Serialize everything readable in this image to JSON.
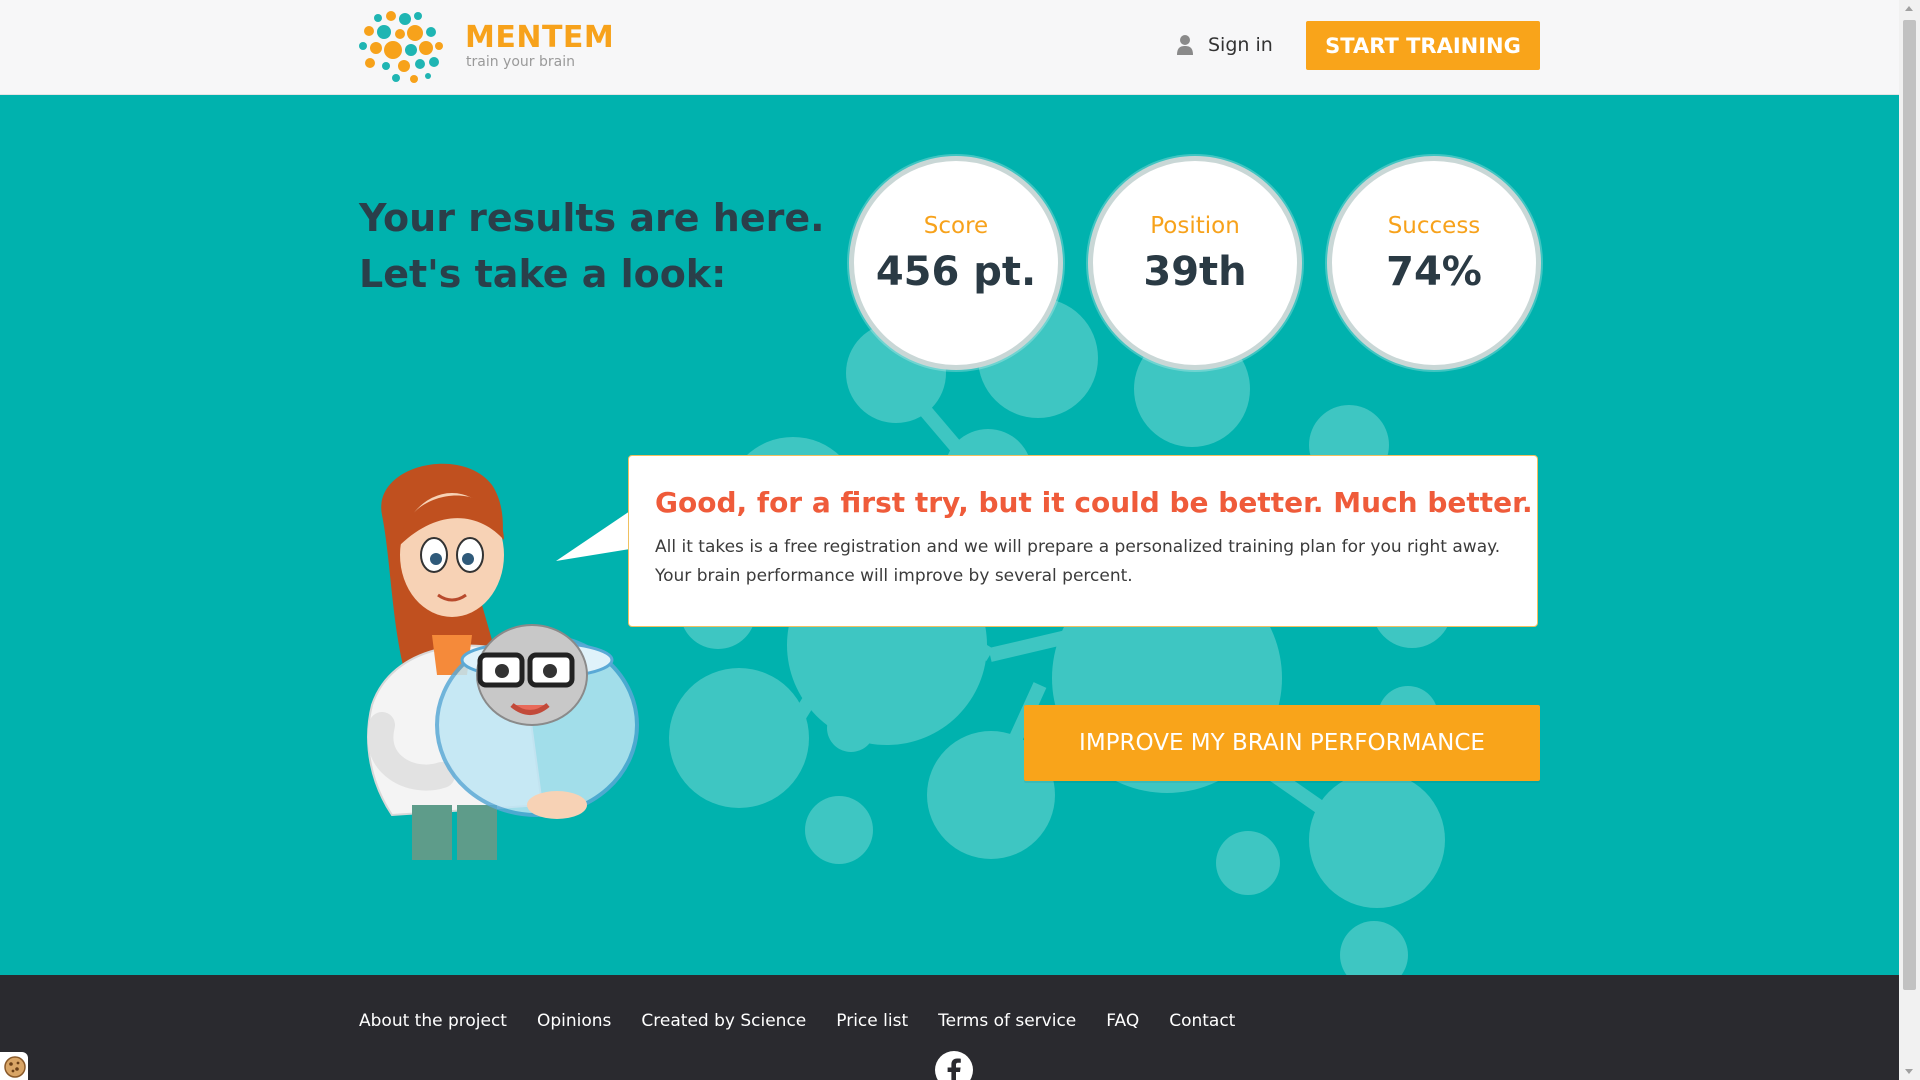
{
  "header": {
    "brand_name": "MENTEM",
    "brand_tagline": "train your brain",
    "signin_label": "Sign in",
    "start_button_label": "START TRAINING",
    "icons": {
      "logo": "molecule-logo-icon",
      "signin": "person-icon"
    }
  },
  "hero": {
    "headline_line1": "Your results are here.",
    "headline_line2": "Let's take a look:",
    "stats": [
      {
        "label": "Score",
        "value": "456 pt."
      },
      {
        "label": "Position",
        "value": "39th"
      },
      {
        "label": "Success",
        "value": "74%"
      }
    ],
    "message": {
      "title": "Good, for a first try, but it could be better. Much better.",
      "line1": "All it takes is a free registration and we will prepare a personalized training plan for you right away.",
      "line2": "Your brain performance will improve by several percent."
    },
    "cta_label": "IMPROVE MY BRAIN PERFORMANCE"
  },
  "footer": {
    "links": [
      "About the project",
      "Opinions",
      "Created by Science",
      "Price list",
      "Terms of service",
      "FAQ",
      "Contact"
    ],
    "social_icon": "facebook-icon"
  },
  "colors": {
    "accent": "#f9a41a",
    "hero_bg": "#00b2ae",
    "headline": "#2a3f4a",
    "message_title": "#ef5b3a",
    "footer_bg": "#2a2a2f"
  }
}
